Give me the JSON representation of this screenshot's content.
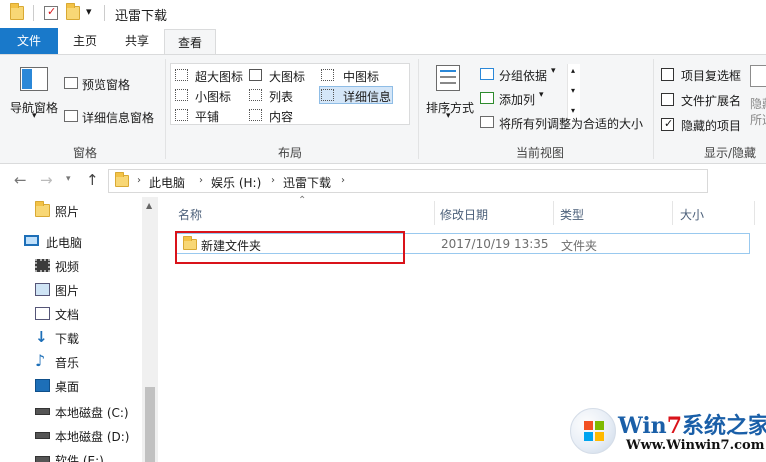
{
  "window": {
    "title": "迅雷下载"
  },
  "tabs": [
    {
      "label": "文件"
    },
    {
      "label": "主页"
    },
    {
      "label": "共享"
    },
    {
      "label": "查看"
    }
  ],
  "ribbon": {
    "panes": {
      "nav_pane": "导航窗格",
      "preview_pane": "预览窗格",
      "details_pane": "详细信息窗格",
      "group_label": "窗格"
    },
    "layout": {
      "items": [
        "超大图标",
        "大图标",
        "中图标",
        "小图标",
        "列表",
        "详细信息",
        "平铺",
        "内容"
      ],
      "selected": "详细信息",
      "group_label": "布局"
    },
    "current_view": {
      "sort_by": "排序方式",
      "group_by": "分组依据",
      "add_column": "添加列",
      "size_all_columns": "将所有列调整为合适的大小",
      "group_label": "当前视图"
    },
    "show_hide": {
      "item_checkboxes": {
        "label": "项目复选框",
        "checked": false
      },
      "file_extensions": {
        "label": "文件扩展名",
        "checked": false
      },
      "hidden_items": {
        "label": "隐藏的项目",
        "checked": true
      },
      "hide_selected_partial": "隐藏",
      "hide_selected_partial2": "所选",
      "group_label": "显示/隐藏"
    }
  },
  "address": {
    "crumbs": [
      "此电脑",
      "娱乐 (H:)",
      "迅雷下载"
    ]
  },
  "nav_pane": {
    "items": [
      {
        "label": "照片",
        "icon": "folder-icon"
      },
      {
        "label": "此电脑",
        "icon": "computer-icon"
      },
      {
        "label": "视频",
        "icon": "video-icon"
      },
      {
        "label": "图片",
        "icon": "pictures-icon"
      },
      {
        "label": "文档",
        "icon": "documents-icon"
      },
      {
        "label": "下载",
        "icon": "download-icon"
      },
      {
        "label": "音乐",
        "icon": "music-icon"
      },
      {
        "label": "桌面",
        "icon": "desktop-icon"
      },
      {
        "label": "本地磁盘 (C:)",
        "icon": "drive-icon"
      },
      {
        "label": "本地磁盘 (D:)",
        "icon": "drive-icon"
      },
      {
        "label": "软件 (E:)",
        "icon": "drive-icon"
      }
    ]
  },
  "file_list": {
    "columns": [
      "名称",
      "修改日期",
      "类型",
      "大小"
    ],
    "rows": [
      {
        "name": "新建文件夹",
        "modified": "2017/10/19 13:35",
        "type": "文件夹",
        "size": ""
      }
    ]
  },
  "watermark": {
    "brand_prefix": "Win",
    "brand_num": "7",
    "brand_suffix": "系统之家",
    "url": "Www.Winwin7.com"
  },
  "colors": {
    "file_tab": "#1979ca",
    "highlight": "#d9131a",
    "watermark_text": "#1a5fa8"
  }
}
